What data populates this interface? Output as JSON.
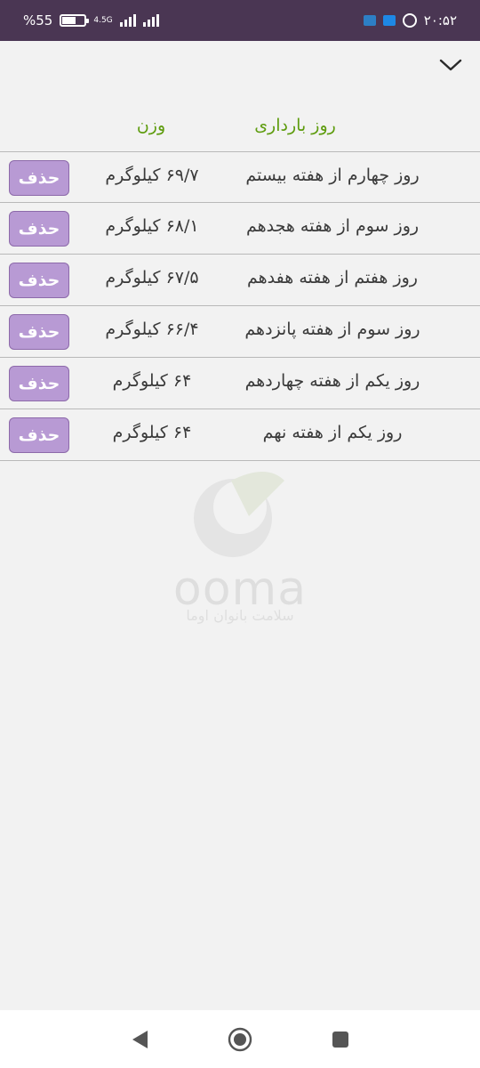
{
  "status_bar": {
    "time": "۲۰:۵۲",
    "battery": "55",
    "battery_prefix": "%",
    "network": "4.5G"
  },
  "table": {
    "header_day": "روز بارداری",
    "header_weight": "وزن",
    "delete_label": "حذف",
    "rows": [
      {
        "day": "روز چهارم از هفته بیستم",
        "weight": "۶۹/۷ کیلوگرم"
      },
      {
        "day": "روز سوم از هفته هجدهم",
        "weight": "۶۸/۱ کیلوگرم"
      },
      {
        "day": "روز هفتم از هفته هفدهم",
        "weight": "۶۷/۵ کیلوگرم"
      },
      {
        "day": "روز سوم از هفته پانزدهم",
        "weight": "۶۶/۴ کیلوگرم"
      },
      {
        "day": "روز یکم از هفته چهاردهم",
        "weight": "۶۴ کیلوگرم"
      },
      {
        "day": "روز یکم از هفته نهم",
        "weight": "۶۴ کیلوگرم"
      }
    ]
  },
  "watermark": {
    "brand": "ooma",
    "tagline": "سلامت بانوان اوما"
  },
  "icons": {
    "collapse": "chevron-down-icon",
    "back": "back-triangle-icon",
    "home": "home-circle-icon",
    "recents": "recents-square-icon"
  },
  "colors": {
    "status_bar": "#4a3653",
    "header_text": "#5e9c0e",
    "delete_button": "#b89ad4",
    "row_border": "#b9b9b9"
  }
}
